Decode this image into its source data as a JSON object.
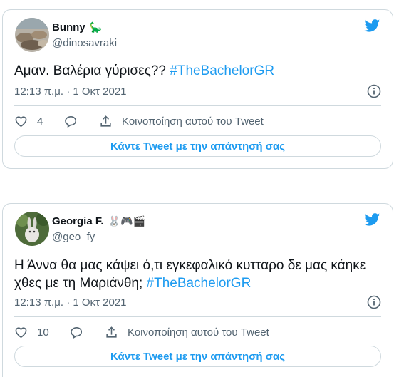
{
  "tweets": [
    {
      "display_name": "Bunny",
      "name_emoji": "🦕",
      "handle": "@dinosavraki",
      "text": "Αμαν. Βαλέρια γύρισες?? ",
      "hashtag": "#TheBachelorGR",
      "timestamp": "12:13 π.μ. · 1 Οκτ 2021",
      "like_count": "4",
      "share_label": "Κοινοποίηση αυτού του Tweet",
      "reply_button_label": "Κάντε Tweet με την απάντησή σας"
    },
    {
      "display_name": "Georgia F.",
      "name_emoji": "🐰🎮🎬",
      "handle": "@geo_fy",
      "text": "Η Άννα θα μας κάψει ό,τι εγκεφαλικό κυτταρο δε μας κάηκε χθες με τη Μαριάνθη; ",
      "hashtag": "#TheBachelorGR",
      "timestamp": "12:13 π.μ. · 1 Οκτ 2021",
      "like_count": "10",
      "share_label": "Κοινοποίηση αυτού του Tweet",
      "reply_button_label": "Κάντε Tweet με την απάντησή σας"
    }
  ],
  "colors": {
    "accent": "#1d9bf0",
    "text": "#0f1419",
    "secondary": "#536471",
    "border": "#cfd9de"
  },
  "icons": [
    "twitter-bird-icon",
    "info-icon",
    "heart-icon",
    "reply-bubble-icon",
    "share-icon"
  ]
}
